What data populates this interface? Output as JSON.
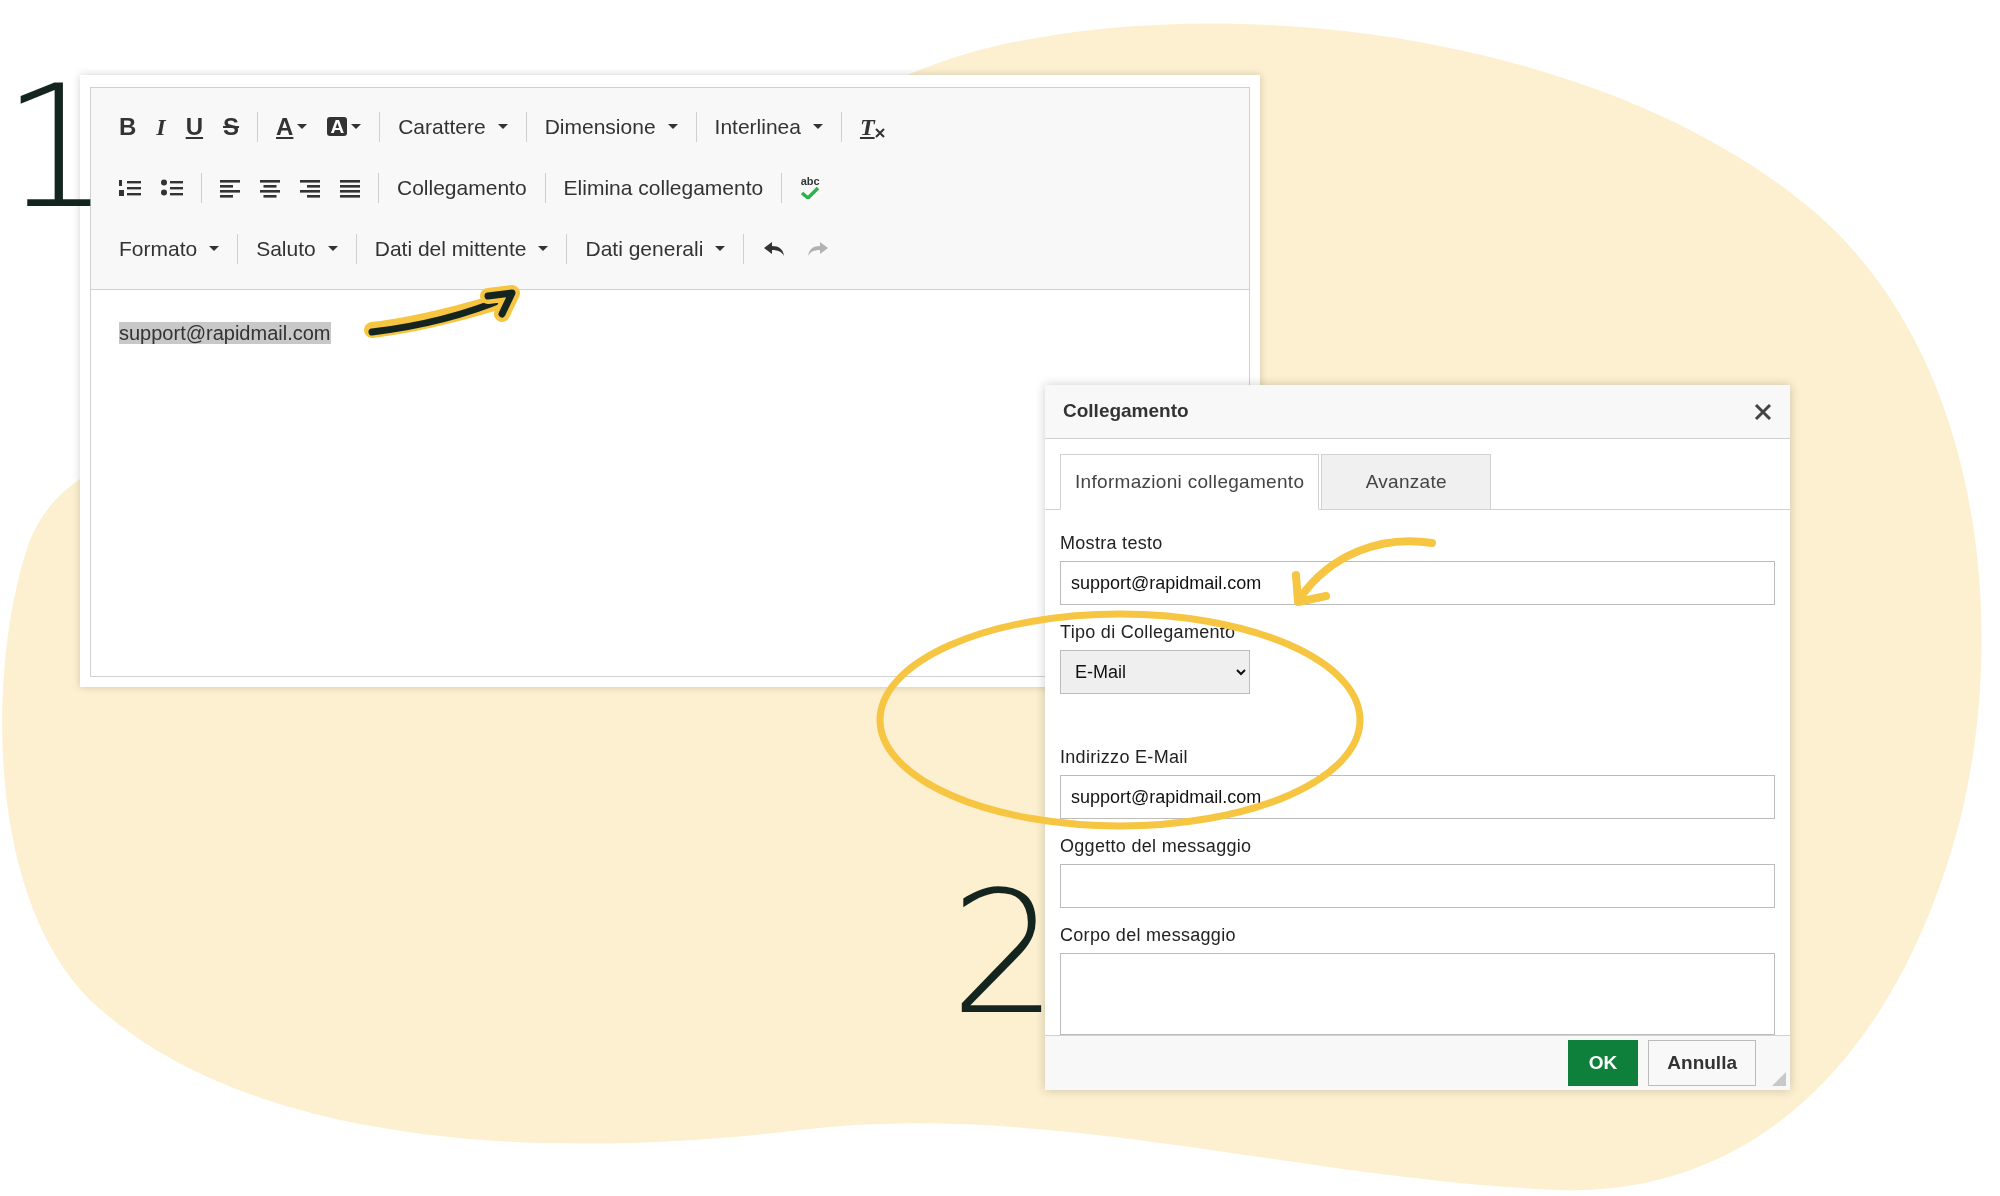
{
  "editor": {
    "toolbar": [
      [
        [
          {
            "kind": "bold",
            "glyph": "B",
            "disabled": false
          },
          {
            "kind": "italic",
            "glyph": "I",
            "disabled": false
          },
          {
            "kind": "underline",
            "glyph": "U",
            "disabled": false
          },
          {
            "kind": "strike",
            "glyph": "S",
            "disabled": false
          }
        ],
        [
          {
            "kind": "textcolor",
            "glyph": "A",
            "disabled": false
          },
          {
            "kind": "bgcolor",
            "glyph": "A",
            "disabled": false
          }
        ],
        [
          {
            "kind": "dropdown",
            "label": "Carattere",
            "disabled": false
          }
        ],
        [
          {
            "kind": "dropdown",
            "label": "Dimensione",
            "disabled": false
          }
        ],
        [
          {
            "kind": "dropdown",
            "label": "Interlinea",
            "disabled": false
          }
        ],
        [
          {
            "kind": "removeformat",
            "glyph": "T",
            "disabled": false
          }
        ]
      ],
      [
        [
          {
            "kind": "numlist",
            "disabled": false
          },
          {
            "kind": "bullist",
            "disabled": false
          }
        ],
        [
          {
            "kind": "alignleft",
            "disabled": false
          },
          {
            "kind": "aligncenter",
            "disabled": false
          },
          {
            "kind": "alignright",
            "disabled": false
          },
          {
            "kind": "justify",
            "disabled": false
          }
        ],
        [
          {
            "kind": "text",
            "label": "Collegamento",
            "disabled": false
          }
        ],
        [
          {
            "kind": "text",
            "label": "Elimina collegamento",
            "disabled": false
          }
        ],
        [
          {
            "kind": "spellcheck",
            "glyph": "abc",
            "disabled": false
          }
        ]
      ],
      [
        [
          {
            "kind": "dropdown",
            "label": "Formato",
            "disabled": false
          }
        ],
        [
          {
            "kind": "dropdown",
            "label": "Saluto",
            "disabled": false
          }
        ],
        [
          {
            "kind": "dropdown",
            "label": "Dati del mittente",
            "disabled": false
          }
        ],
        [
          {
            "kind": "dropdown",
            "label": "Dati generali",
            "disabled": false
          }
        ],
        [
          {
            "kind": "undo",
            "disabled": false
          },
          {
            "kind": "redo",
            "disabled": true
          }
        ]
      ]
    ],
    "content": {
      "text": "support@rapidmail.com",
      "selected": true
    }
  },
  "dialog": {
    "title": "Collegamento",
    "tabs": [
      {
        "label": "Informazioni collegamento",
        "selected": true
      },
      {
        "label": "Avanzate",
        "selected": false
      }
    ],
    "fields": [
      {
        "kind": "text",
        "label": "Mostra testo",
        "value": "support@rapidmail.com"
      },
      {
        "kind": "select",
        "label": "Tipo di Collegamento",
        "value": "E-Mail"
      },
      {
        "kind": "text",
        "label": "Indirizzo E-Mail",
        "value": "support@rapidmail.com"
      },
      {
        "kind": "text",
        "label": "Oggetto del messaggio"
      },
      {
        "kind": "textarea",
        "label": "Corpo del messaggio"
      }
    ],
    "buttons": [
      {
        "kind": "primary",
        "label": "OK"
      },
      {
        "kind": "secondary",
        "label": "Annulla"
      }
    ]
  },
  "step_numbers": [
    "1",
    "2"
  ]
}
